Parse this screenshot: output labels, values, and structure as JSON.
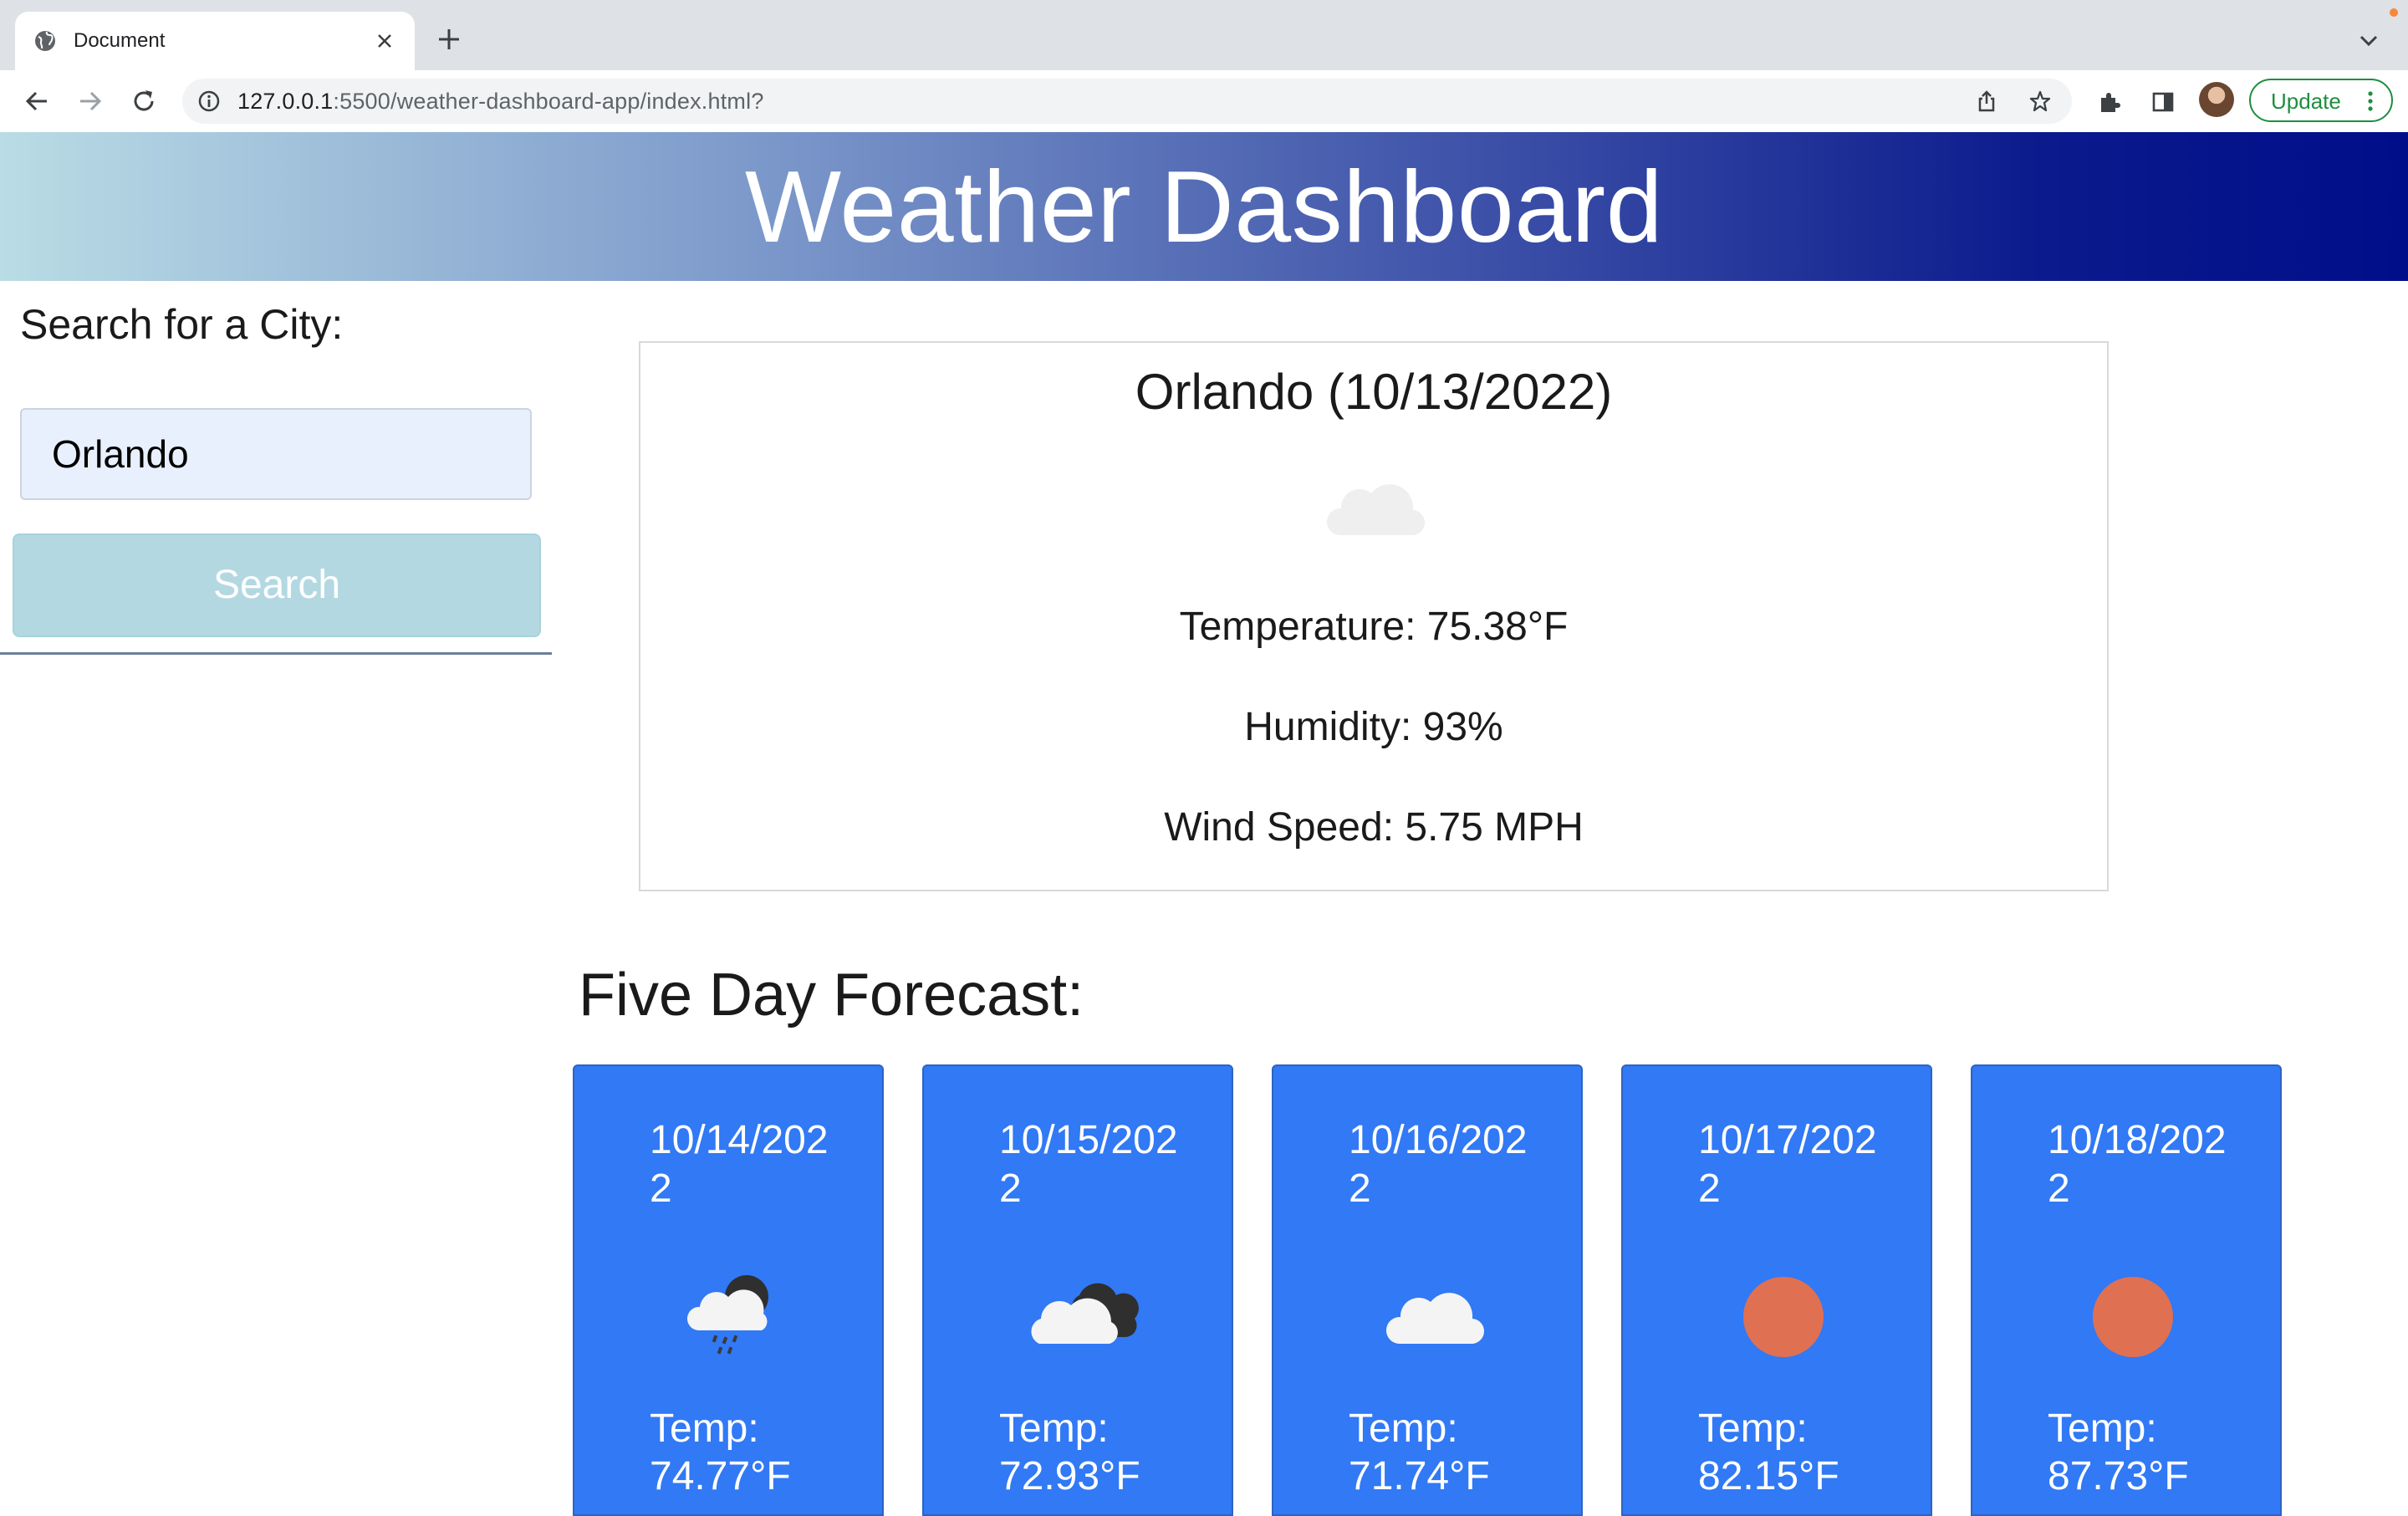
{
  "browser": {
    "tab_title": "Document",
    "url_host": "127.0.0.1",
    "url_rest": ":5500/weather-dashboard-app/index.html?",
    "update_label": "Update"
  },
  "header": {
    "title": "Weather Dashboard"
  },
  "sidebar": {
    "search_label": "Search for a City:",
    "input_value": "Orlando",
    "search_button": "Search"
  },
  "current": {
    "city_date": "Orlando (10/13/2022)",
    "icon": "cloud-icon",
    "temperature": "Temperature: 75.38°F",
    "humidity": "Humidity: 93%",
    "wind": "Wind Speed: 5.75 MPH"
  },
  "forecast": {
    "title": "Five Day Forecast:",
    "temp_label": "Temp:",
    "days": [
      {
        "date": "10/14/2022",
        "icon": "rain-night-icon",
        "temp": "74.77°F"
      },
      {
        "date": "10/15/2022",
        "icon": "broken-clouds-icon",
        "temp": "72.93°F"
      },
      {
        "date": "10/16/2022",
        "icon": "cloud-icon",
        "temp": "71.74°F"
      },
      {
        "date": "10/17/2022",
        "icon": "sun-icon",
        "temp": "82.15°F"
      },
      {
        "date": "10/18/2022",
        "icon": "sun-icon",
        "temp": "87.73°F"
      }
    ]
  },
  "colors": {
    "card_blue": "#3179f5",
    "sun": "#e07052",
    "update_green": "#1e8e3e"
  }
}
